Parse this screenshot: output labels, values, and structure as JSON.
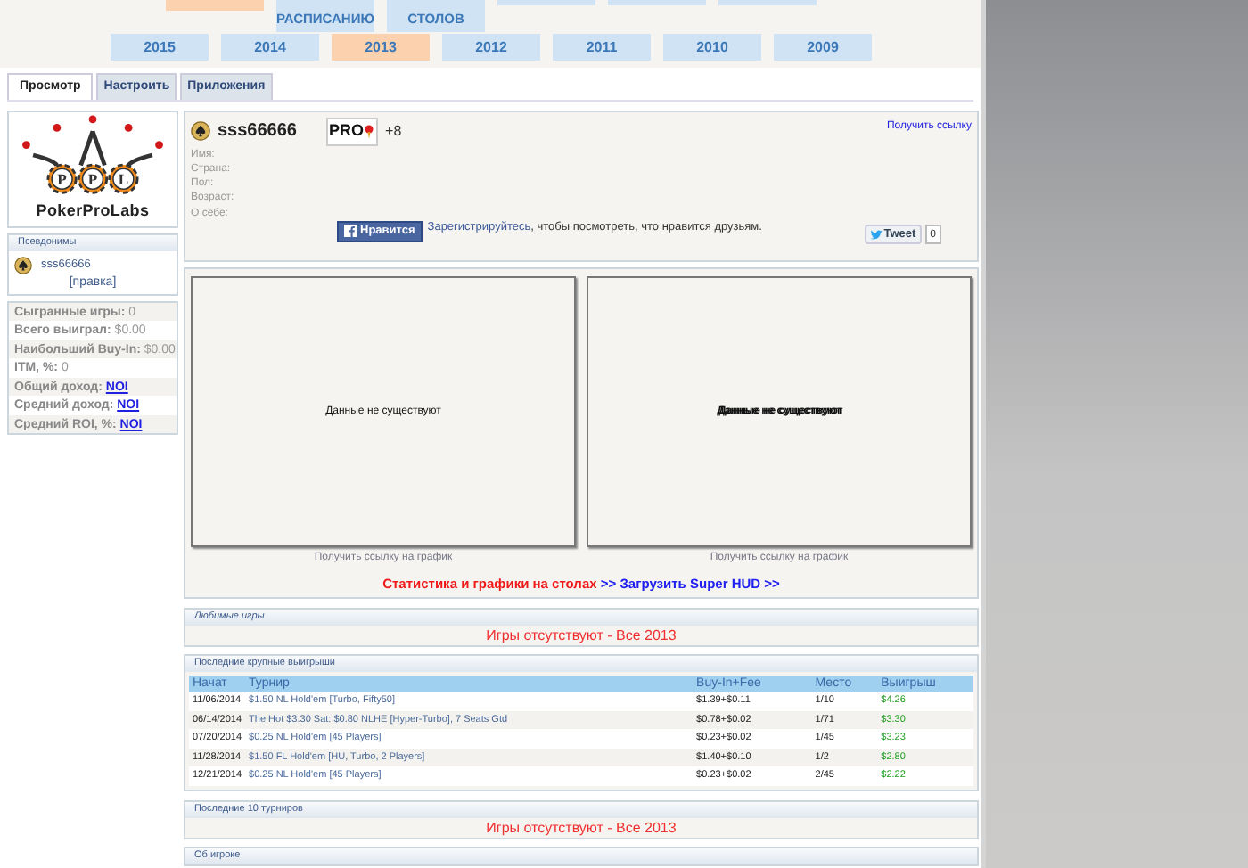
{
  "top_menu": [
    {
      "kind": "cut",
      "selected": true
    },
    {
      "kind": "tab",
      "label": "РАСПИСАНИЮ",
      "selected": false
    },
    {
      "kind": "tab",
      "label": "СТОЛОВ",
      "selected": false
    },
    {
      "kind": "cut",
      "selected": false
    },
    {
      "kind": "cut",
      "selected": false
    },
    {
      "kind": "cut",
      "selected": false
    }
  ],
  "years": [
    {
      "label": "2015",
      "selected": false
    },
    {
      "label": "2014",
      "selected": false
    },
    {
      "label": "2013",
      "selected": true
    },
    {
      "label": "2012",
      "selected": false
    },
    {
      "label": "2011",
      "selected": false
    },
    {
      "label": "2010",
      "selected": false
    },
    {
      "label": "2009",
      "selected": false
    }
  ],
  "tabs": [
    {
      "label": "Просмотр",
      "selected": true
    },
    {
      "label": "Настроить",
      "selected": false
    },
    {
      "label": "Приложения",
      "selected": false
    }
  ],
  "logo": {
    "chips": [
      "P",
      "P",
      "L"
    ],
    "text": "PokerProLabs"
  },
  "aliases": {
    "title": "Псевдонимы",
    "items": [
      "sss66666"
    ],
    "edit_link": "[правка]"
  },
  "stats": [
    {
      "label": "Сыгранные игры:",
      "value": "0",
      "kind": "plain"
    },
    {
      "label": "Всего выиграл:",
      "value": "$0.00",
      "kind": "plain"
    },
    {
      "label": "Наибольший Buy-In:",
      "value": "$0.00",
      "kind": "plain"
    },
    {
      "label": "ITM, %:",
      "value": "0",
      "kind": "plain"
    },
    {
      "label": "Общий доход:",
      "value": "NOI",
      "kind": "link"
    },
    {
      "label": "Средний доход:",
      "value": "NOI",
      "kind": "link"
    },
    {
      "label": "Средний ROI, %:",
      "value": "NOI",
      "kind": "link"
    }
  ],
  "profile": {
    "name": "sss66666",
    "badge": "PRO",
    "score": "+8",
    "get_link": "Получить ссылку",
    "fields": [
      "Имя:",
      "Страна:",
      "Пол:",
      "Возраст:",
      "О себе:"
    ],
    "like_button": "Нравится",
    "like_text": "Зарегистрируйтесь",
    "like_text_rest": ", чтобы посмотреть, что нравится друзьям.",
    "tweet_button": "Tweet",
    "tweet_count": "0"
  },
  "graphs": [
    {
      "message": "Данные не существуют",
      "emphasized": false,
      "link": "Получить ссылку на график"
    },
    {
      "message": "Данные не существуют",
      "emphasized": true,
      "link": "Получить ссылку на график"
    }
  ],
  "promo": {
    "text": "Статистика и графики на столах",
    "link": ">> Загрузить Super HUD >>"
  },
  "favorite_games": {
    "title": "Любимые игры",
    "empty_text": "Игры отсутствуют - Все 2013"
  },
  "big_wins": {
    "title": "Последние крупные выигрыши",
    "columns": [
      "Начат",
      "Турнир",
      "Buy-In+Fee",
      "Место",
      "Выигрыш"
    ],
    "rows": [
      [
        "11/06/2014",
        "$1.50 NL Hold'em [Turbo, Fifty50]",
        "$1.39+$0.11",
        "1/10",
        "$4.26"
      ],
      [
        "06/14/2014",
        "The Hot $3.30 Sat: $0.80 NLHE [Hyper-Turbo], 7 Seats Gtd",
        "$0.78+$0.02",
        "1/71",
        "$3.30"
      ],
      [
        "07/20/2014",
        "$0.25 NL Hold'em [45 Players]",
        "$0.23+$0.02",
        "1/45",
        "$3.23"
      ],
      [
        "11/28/2014",
        "$1.50 FL Hold'em [HU, Turbo, 2 Players]",
        "$1.40+$0.10",
        "1/2",
        "$2.80"
      ],
      [
        "12/21/2014",
        "$0.25 NL Hold'em [45 Players]",
        "$0.23+$0.02",
        "2/45",
        "$2.22"
      ]
    ]
  },
  "last_tournaments": {
    "title": "Последние 10 турниров",
    "empty_text": "Игры отсутствуют - Все 2013"
  },
  "about": {
    "title": "Об игроке"
  }
}
